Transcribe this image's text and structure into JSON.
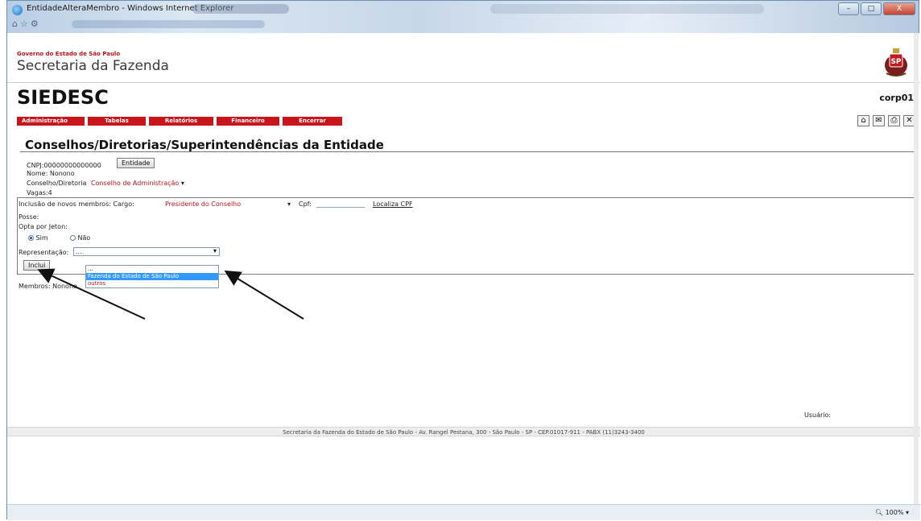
{
  "browser": {
    "title": "EntidadeAlteraMembro - Windows Internet Explorer",
    "zoom": "100%",
    "controls": {
      "minimize": "–",
      "maximize": "□",
      "close": "X"
    }
  },
  "header": {
    "gov_small": "Governo do Estado de São Paulo",
    "gov_big": "Secretaria da Fazenda",
    "app_title": "SIEDESC",
    "user_code": "corp01"
  },
  "menu": [
    "Administração",
    "Tabelas",
    "Relatórios",
    "Financeiro",
    "Encerrar"
  ],
  "tool_icons": [
    "home-icon",
    "mail-icon",
    "print-icon",
    "close-icon"
  ],
  "page": {
    "title": "Conselhos/Diretorias/Superintendências da Entidade",
    "cnpj": "CNPJ:00000000000000",
    "entidade_button": "Entidade",
    "nome": "Nome: Nonono",
    "conselho_label": "Conselho/Diretoria",
    "conselho_value": "Conselho de Administração",
    "vagas": "Vagas:4"
  },
  "form": {
    "inclusao_label": "Inclusão de novos membros: Cargo:",
    "cargo_value": "Presidente do Conselho",
    "cpf_label": "Cpf:",
    "localiza_link": "Localiza CPF",
    "posse_label": "Posse:",
    "jeton_label": "Opta por Jeton:",
    "sim": "Sim",
    "nao": "Não",
    "representacao_label": "Representação:",
    "representacao_value": "...",
    "inclui_button": "Inclui",
    "dropdown_options": [
      "...",
      "Fazenda do Estado de São Paulo",
      "outros"
    ],
    "dropdown_selected": "Fazenda do Estado de São Paulo"
  },
  "membros": "Membros: Nonono",
  "usuario_label": "Usuário:",
  "footer": "Secretaria da Fazenda do Estado de São Paulo - Av. Rangel Pestana, 300 - São Paulo - SP - CEP.01017-911 - PABX (11)3243-3400"
}
